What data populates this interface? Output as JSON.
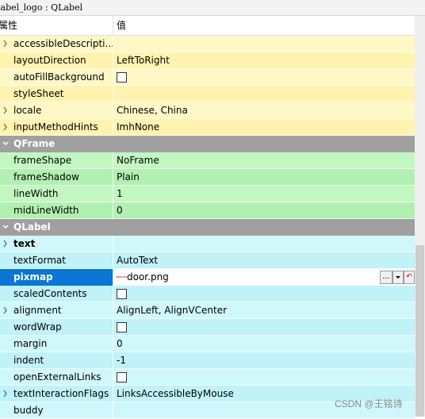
{
  "title": "label_logo : QLabel",
  "header": {
    "col_property": "属性",
    "col_value": "值"
  },
  "colors": {
    "yellow": "#fff8c6",
    "yellow_alt": "#fff3b0",
    "green": "#c2f7c2",
    "green_alt": "#b2f0b2",
    "cyan": "#d0f8fc",
    "cyan_alt": "#c0f2f8",
    "section": "#a0a0a0",
    "selected": "#0a76d4"
  },
  "rows": [
    {
      "name": "accessibleDescripti...",
      "value": "",
      "group": "yellow",
      "expand": true
    },
    {
      "name": "layoutDirection",
      "value": "LeftToRight",
      "group": "yellow"
    },
    {
      "name": "autoFillBackground",
      "value": "",
      "group": "yellow",
      "checkbox": true,
      "checked": false
    },
    {
      "name": "styleSheet",
      "value": "",
      "group": "yellow"
    },
    {
      "name": "locale",
      "value": "Chinese, China",
      "group": "yellow",
      "expand": true
    },
    {
      "name": "inputMethodHints",
      "value": "ImhNone",
      "group": "yellow",
      "expand": true
    },
    {
      "name": "QFrame",
      "section": true
    },
    {
      "name": "frameShape",
      "value": "NoFrame",
      "group": "green"
    },
    {
      "name": "frameShadow",
      "value": "Plain",
      "group": "green"
    },
    {
      "name": "lineWidth",
      "value": "1",
      "group": "green"
    },
    {
      "name": "midLineWidth",
      "value": "0",
      "group": "green"
    },
    {
      "name": "QLabel",
      "section": true
    },
    {
      "name": "text",
      "value": "",
      "group": "cyan",
      "expand": true,
      "bold": true
    },
    {
      "name": "textFormat",
      "value": "AutoText",
      "group": "cyan"
    },
    {
      "name": "pixmap",
      "value": "door.png",
      "group": "cyan",
      "selected": true
    },
    {
      "name": "scaledContents",
      "value": "",
      "group": "cyan",
      "checkbox": true,
      "checked": false
    },
    {
      "name": "alignment",
      "value": "AlignLeft, AlignVCenter",
      "group": "cyan",
      "expand": true
    },
    {
      "name": "wordWrap",
      "value": "",
      "group": "cyan",
      "checkbox": true,
      "checked": false
    },
    {
      "name": "margin",
      "value": "0",
      "group": "cyan"
    },
    {
      "name": "indent",
      "value": "-1",
      "group": "cyan"
    },
    {
      "name": "openExternalLinks",
      "value": "",
      "group": "cyan",
      "checkbox": true,
      "checked": false
    },
    {
      "name": "textInteractionFlags",
      "value": "LinksAccessibleByMouse",
      "group": "cyan",
      "expand": true
    },
    {
      "name": "buddy",
      "value": "",
      "group": "cyan"
    }
  ],
  "pixmap_buttons": {
    "browse": "...",
    "reset": "↶"
  },
  "watermark": "CSDN @王铭诗"
}
